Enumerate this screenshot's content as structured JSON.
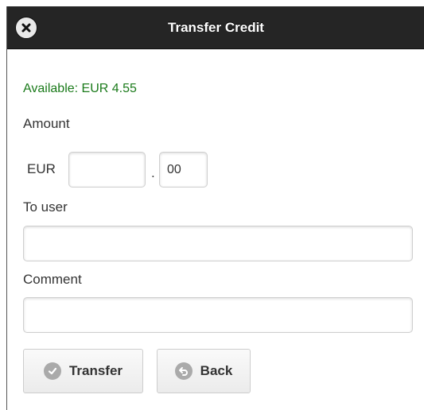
{
  "header": {
    "title": "Transfer Credit",
    "close_icon": "close-icon"
  },
  "balance": {
    "text": "Available: EUR 4.55"
  },
  "amount": {
    "label": "Amount",
    "currency": "EUR",
    "integer_value": "",
    "separator": ".",
    "cents_value": "00"
  },
  "to_user": {
    "label": "To user",
    "value": ""
  },
  "comment": {
    "label": "Comment",
    "value": ""
  },
  "buttons": {
    "transfer": {
      "label": "Transfer",
      "icon": "check-circle-icon"
    },
    "back": {
      "label": "Back",
      "icon": "back-arrow-icon"
    }
  },
  "colors": {
    "header_bg": "#252525",
    "available_text": "#1a7a1a"
  }
}
